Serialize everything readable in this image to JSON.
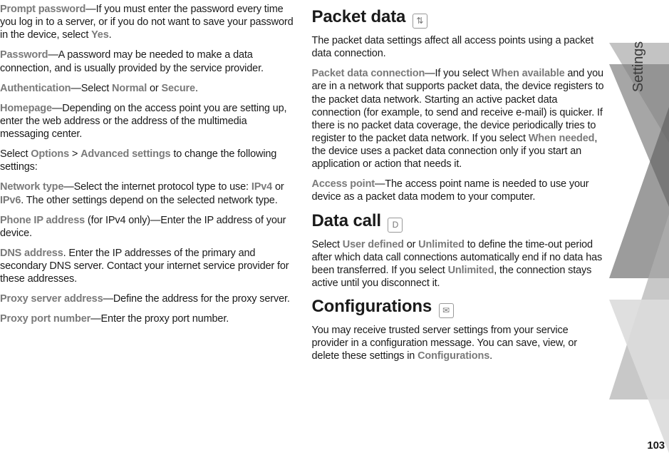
{
  "left": {
    "p1_bold": "Prompt password",
    "p1_text": "—If you must enter the password every time you log in to a server, or if you do not want to save your password in the device, select ",
    "p1_yes": "Yes",
    "p1_tail": ".",
    "p2_bold": "Password",
    "p2_text": "—A password may be needed to make a data connection, and is usually provided by the service provider.",
    "p3_bold": "Authentication",
    "p3_pre": "—Select ",
    "p3_opt1": "Normal",
    "p3_mid": " or ",
    "p3_opt2": "Secure",
    "p3_tail": ".",
    "p4_bold": "Homepage",
    "p4_text": "—Depending on the access point you are setting up, enter the web address or the address of the multimedia messaging center.",
    "p5_pre": "Select ",
    "p5_opt": "Options",
    "p5_gt": " > ",
    "p5_adv": "Advanced settings",
    "p5_tail": " to change the following settings:",
    "p6_bold": "Network type",
    "p6_pre": "—Select the internet protocol type to use: ",
    "p6_opt1": "IPv4",
    "p6_mid": " or ",
    "p6_opt2": "IPv6",
    "p6_tail": ". The other settings depend on the selected network type.",
    "p7_bold": "Phone IP address",
    "p7_text": " (for IPv4 only)—Enter the IP address of your device.",
    "p8_bold": "DNS address",
    "p8_text": ". Enter the IP addresses of the primary and secondary DNS server. Contact your internet service provider for these addresses.",
    "p9_bold": "Proxy server address",
    "p9_text": "—Define the address for the proxy server.",
    "p10_bold": "Proxy port number",
    "p10_text": "—Enter the proxy port number."
  },
  "right": {
    "h1": "Packet data",
    "r1": "The packet data settings affect all access points using a packet data connection.",
    "r2_bold": "Packet data connection",
    "r2_pre": "—If you select ",
    "r2_opt1": "When available",
    "r2_mid": " and you are in a network that supports packet data, the device registers to the packet data network. Starting an active packet data connection (for example, to send and receive e-mail) is quicker. If there is no packet data coverage, the device periodically tries to register to the packet data network. If you select ",
    "r2_opt2": "When needed",
    "r2_tail": ", the device uses a packet data connection only if you start an application or action that needs it.",
    "r3_bold": "Access point",
    "r3_text": "—The access point name is needed to use your device as a packet data modem to your computer.",
    "h2": "Data call",
    "r4_pre": "Select ",
    "r4_opt1": "User defined",
    "r4_mid": " or ",
    "r4_opt2": "Unlimited",
    "r4_m2": " to define the time-out period after which data call connections automatically end if no data has been transferred. If you select ",
    "r4_opt3": "Unlimited",
    "r4_tail": ", the connection stays active until you disconnect it.",
    "h3": "Configurations",
    "r5_pre": "You may receive trusted server settings from your service provider in a configuration message. You can save, view, or delete these settings in ",
    "r5_bold": "Configurations",
    "r5_tail": "."
  },
  "side": {
    "label": "Settings",
    "page": "103"
  },
  "icons": {
    "packet": "⇅",
    "datacall": "D",
    "config": "✉"
  }
}
